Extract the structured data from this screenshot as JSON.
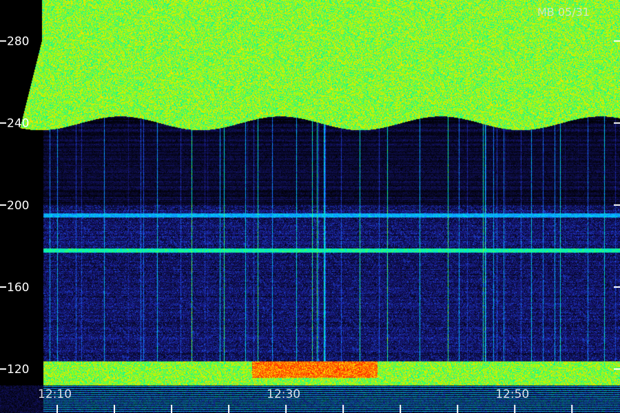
{
  "stamp": "MB 05/31",
  "chart_data": {
    "type": "heatmap",
    "title": "",
    "xlabel": "",
    "ylabel": "",
    "y_ticks": [
      280,
      240,
      200,
      160,
      120
    ],
    "y_tick_labels": [
      "-280",
      "-240",
      "-200",
      "-160",
      "-120"
    ],
    "ylim": [
      112,
      300
    ],
    "x_tick_labels": [
      {
        "label": "12:10",
        "minute": 10
      },
      {
        "label": "12:30",
        "minute": 30
      },
      {
        "label": "12:50",
        "minute": 50
      }
    ],
    "x_minor_tick_minutes": [
      10,
      15,
      20,
      25,
      30,
      35,
      40,
      45,
      50,
      55
    ],
    "xlim_minutes": [
      5,
      59.2
    ],
    "colormap": [
      "#000000",
      "#1a1a8c",
      "#1e5cff",
      "#00c8ff",
      "#00ff9a",
      "#a8ff00",
      "#ffe000",
      "#ff2a00"
    ],
    "bands": [
      {
        "name": "upper",
        "from": 240,
        "to": 300,
        "intensity": 0.7
      },
      {
        "name": "lower",
        "from": 112,
        "to": 124,
        "intensity": 0.7
      },
      {
        "name": "line",
        "at": 178,
        "intensity": 0.55
      },
      {
        "name": "line",
        "at": 195,
        "intensity": 0.4
      }
    ],
    "hot_region": {
      "from_minute": 27,
      "to_minute": 38,
      "from": 116,
      "to": 124,
      "intensity": 0.95
    }
  }
}
